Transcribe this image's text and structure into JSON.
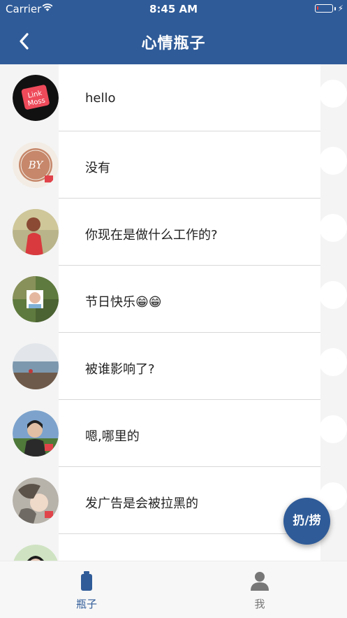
{
  "status_bar": {
    "carrier": "Carrier",
    "time": "8:45 AM",
    "battery_level": 0.1
  },
  "nav": {
    "title": "心情瓶子",
    "back_icon": "chevron-left-icon"
  },
  "messages": [
    {
      "text": "hello"
    },
    {
      "text": "没有"
    },
    {
      "text": "你现在是做什么工作的?"
    },
    {
      "text": "节日快乐😁😁"
    },
    {
      "text": "被谁影响了?"
    },
    {
      "text": "嗯,哪里的"
    },
    {
      "text": "发广告是会被拉黑的"
    },
    {
      "text": ""
    }
  ],
  "avatar_logo": {
    "line1": "Link",
    "line2": "Moss",
    "badge_letters": "BY"
  },
  "fab": {
    "label": "扔/捞"
  },
  "tabs": [
    {
      "label": "瓶子",
      "icon": "bottle-icon",
      "active": true
    },
    {
      "label": "我",
      "icon": "person-icon",
      "active": false
    }
  ],
  "colors": {
    "brand": "#2f5b98",
    "background": "#f4f4f4",
    "inactive_tab": "#777777"
  }
}
